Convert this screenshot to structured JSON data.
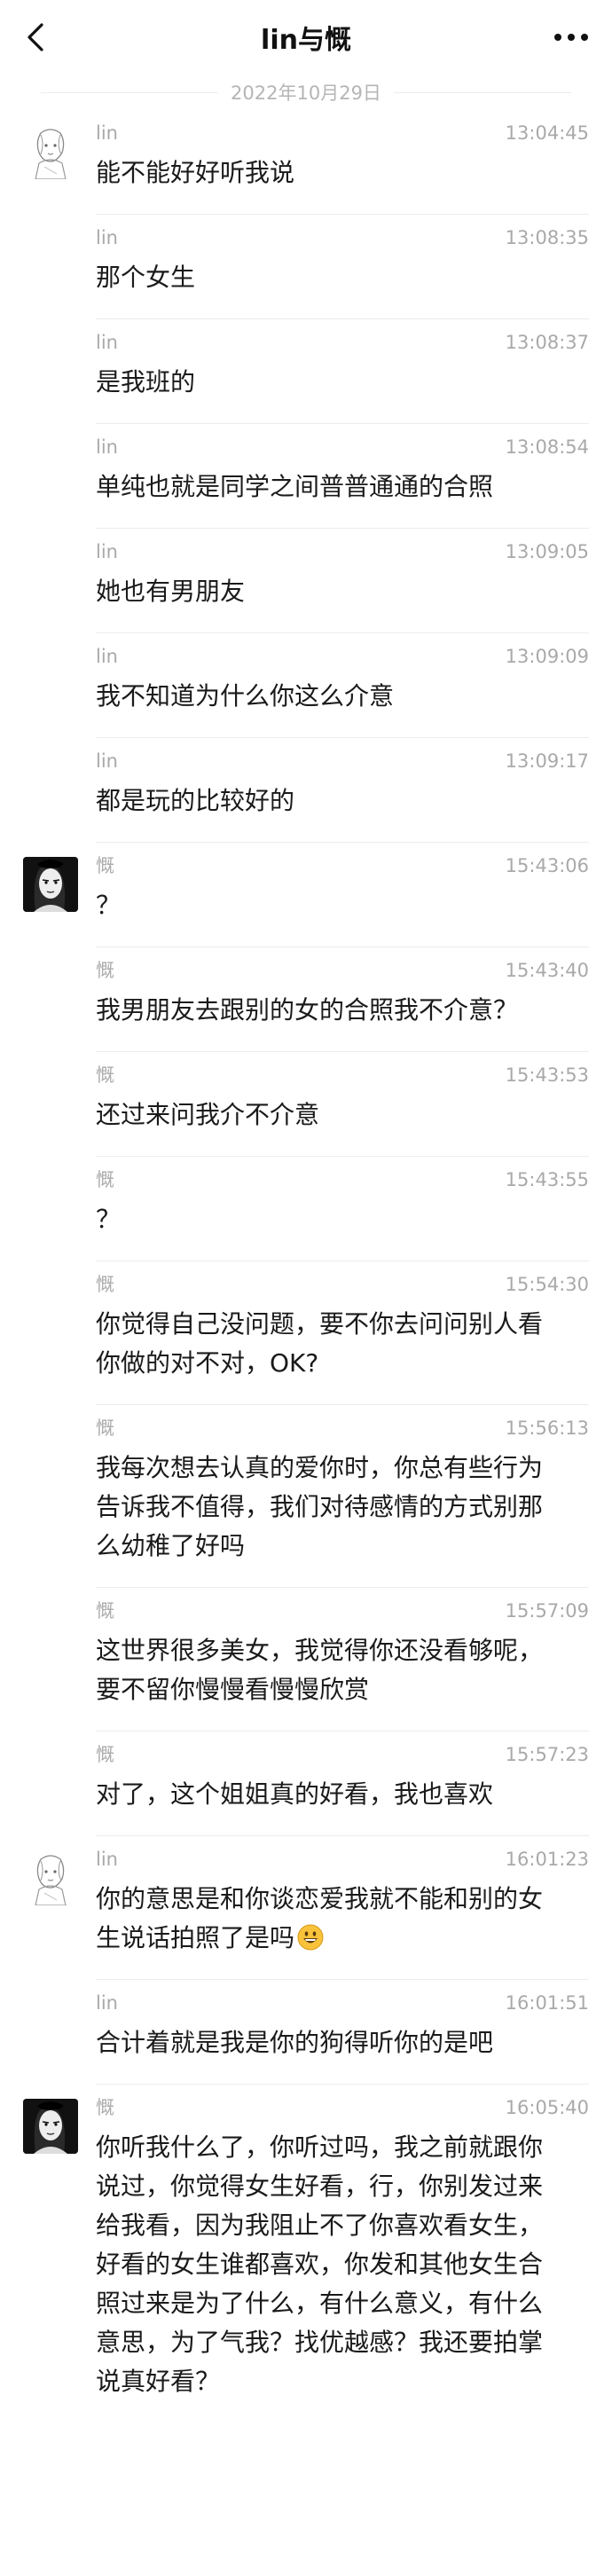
{
  "header": {
    "title": "lin与慨",
    "back_icon": "chevron-left-icon",
    "more_icon": "more-dots-icon"
  },
  "date_separator": "2022年10月29日",
  "avatars": {
    "lin": "sketch-avatar-lin",
    "kai": "dark-portrait-avatar-kai"
  },
  "messages": [
    {
      "sender": "lin",
      "time": "13:04:45",
      "text": "能不能好好听我说"
    },
    {
      "sender": "lin",
      "time": "13:08:35",
      "text": "那个女生"
    },
    {
      "sender": "lin",
      "time": "13:08:37",
      "text": "是我班的"
    },
    {
      "sender": "lin",
      "time": "13:08:54",
      "text": "单纯也就是同学之间普普通通的合照"
    },
    {
      "sender": "lin",
      "time": "13:09:05",
      "text": "她也有男朋友"
    },
    {
      "sender": "lin",
      "time": "13:09:09",
      "text": "我不知道为什么你这么介意"
    },
    {
      "sender": "lin",
      "time": "13:09:17",
      "text": "都是玩的比较好的"
    },
    {
      "sender": "慨",
      "time": "15:43:06",
      "text": "？"
    },
    {
      "sender": "慨",
      "time": "15:43:40",
      "text": "我男朋友去跟别的女的合照我不介意？"
    },
    {
      "sender": "慨",
      "time": "15:43:53",
      "text": "还过来问我介不介意"
    },
    {
      "sender": "慨",
      "time": "15:43:55",
      "text": "？"
    },
    {
      "sender": "慨",
      "time": "15:54:30",
      "text": "你觉得自己没问题，要不你去问问别人看\n你做的对不对，OK?"
    },
    {
      "sender": "慨",
      "time": "15:56:13",
      "text": "我每次想去认真的爱你时，你总有些行为\n告诉我不值得，我们对待感情的方式别那\n么幼稚了好吗"
    },
    {
      "sender": "慨",
      "time": "15:57:09",
      "text": "这世界很多美女，我觉得你还没看够呢，\n要不留你慢慢看慢慢欣赏"
    },
    {
      "sender": "慨",
      "time": "15:57:23",
      "text": "对了，这个姐姐真的好看，我也喜欢"
    },
    {
      "sender": "lin",
      "time": "16:01:23",
      "text": "你的意思是和你谈恋爱我就不能和别的女\n生说话拍照了是吗",
      "emoji": "grinning-face-emoji"
    },
    {
      "sender": "lin",
      "time": "16:01:51",
      "text": "合计着就是我是你的狗得听你的是吧"
    },
    {
      "sender": "慨",
      "time": "16:05:40",
      "text": "你听我什么了，你听过吗，我之前就跟你\n说过，你觉得女生好看，行，你别发过来\n给我看，因为我阻止不了你喜欢看女生，\n好看的女生谁都喜欢，你发和其他女生合\n照过来是为了什么，有什么意义，有什么\n意思，为了气我？找优越感？我还要拍掌\n说真好看？"
    }
  ]
}
